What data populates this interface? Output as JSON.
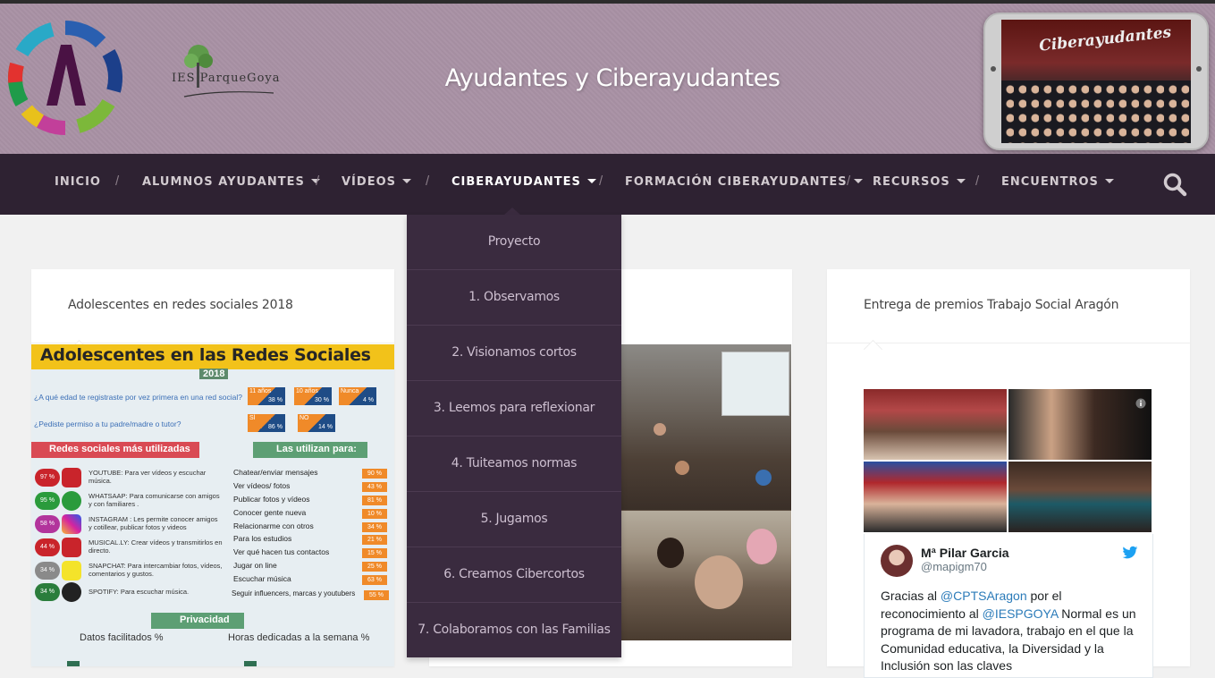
{
  "site": {
    "title": "Ayudantes y Ciberayudantes",
    "ies_logo_text": "IES ParqueGoya",
    "phone_banner_text": "Ciberayudantes"
  },
  "nav": {
    "items": [
      {
        "label": "INICIO",
        "has_caret": false
      },
      {
        "label": "ALUMNOS AYUDANTES",
        "has_caret": true
      },
      {
        "label": "VÍDEOS",
        "has_caret": true
      },
      {
        "label": "CIBERAYUDANTES",
        "has_caret": true,
        "active": true
      },
      {
        "label": "FORMACIÓN CIBERAYUDANTES",
        "has_caret": true
      },
      {
        "label": "RECURSOS",
        "has_caret": true
      },
      {
        "label": "ENCUENTROS",
        "has_caret": true
      }
    ],
    "separator": "/"
  },
  "dropdown": {
    "items": [
      "Proyecto",
      "1. Observamos",
      "2. Visionamos cortos",
      "3. Leemos para reflexionar",
      "4. Tuiteamos normas",
      "5. Jugamos",
      "6. Creamos Cibercortos",
      "7. Colaboramos con las Familias"
    ]
  },
  "cards": {
    "left_title": "Adolescentes en redes sociales 2018",
    "right_title": "Entrega de premios Trabajo Social Aragón"
  },
  "infographic": {
    "title": "Adolescentes en las Redes Sociales",
    "year": "2018",
    "q1": "¿A qué edad te registraste por vez primera en una red social?",
    "q1_boxes": [
      {
        "a": "11 años",
        "b": "38 %"
      },
      {
        "a": "10 años",
        "b": "30 %"
      },
      {
        "a": "Nunca",
        "b": "4 %"
      }
    ],
    "q2": "¿Pediste permiso a tu padre/madre o tutor?",
    "q2_boxes": [
      {
        "a": "SÍ",
        "b": "86 %"
      },
      {
        "a": "NO",
        "b": "14 %"
      }
    ],
    "section_left": "Redes sociales más utilizadas",
    "section_right": "Las utilizan para:",
    "networks": [
      {
        "pct": "97 %",
        "name": "YOUTUBE",
        "desc": "YOUTUBE: Para ver vídeos y escuchar música.",
        "color": "#c9242b"
      },
      {
        "pct": "95 %",
        "name": "WHATSAAP",
        "desc": "WHATSAAP: Para comunicarse con amigos y con familiares .",
        "color": "#2a9b3c"
      },
      {
        "pct": "58 %",
        "name": "INSTAGRAM",
        "desc": "INSTAGRAM : Les permite conocer amigos y cotillear, publicar fotos y videos",
        "color": "#b2349c"
      },
      {
        "pct": "44 %",
        "name": "MUSICAL.LY",
        "desc": "MUSICAL.LY: Crear vídeos y transmitirlos en directo.",
        "color": "#c9242b"
      },
      {
        "pct": "34 %",
        "name": "SNAPCHAT",
        "desc": "SNAPCHAT: Para intercambiar fotos, vídeos, comentarios y gustos.",
        "color": "#8a8a8a"
      },
      {
        "pct": "34 %",
        "name": "SPOTIFY",
        "desc": "SPOTIFY: Para escuchar música.",
        "color": "#2a7d3c"
      }
    ],
    "uses": [
      {
        "label": "Chatear/enviar mensajes",
        "pct": "90 %"
      },
      {
        "label": "Ver vídeos/ fotos",
        "pct": "43 %"
      },
      {
        "label": "Publicar fotos y vídeos",
        "pct": "81 %"
      },
      {
        "label": "Conocer gente nueva",
        "pct": "10 %"
      },
      {
        "label": "Relacionarme con otros",
        "pct": "34 %"
      },
      {
        "label": "Para los estudios",
        "pct": "21 %"
      },
      {
        "label": "Ver qué hacen tus contactos",
        "pct": "15 %"
      },
      {
        "label": "Jugar on line",
        "pct": "25 %"
      },
      {
        "label": "Escuchar música",
        "pct": "63 %"
      },
      {
        "label": "Seguir influencers, marcas y youtubers",
        "pct": "55 %"
      }
    ],
    "privacy_title": "Privacidad",
    "privacy_left": "Datos facilitados %",
    "privacy_right": "Horas dedicadas a la semana %"
  },
  "tweet": {
    "name": "Mª Pilar Garcia",
    "handle": "@mapigm70",
    "text_1": "Gracias al ",
    "mention_1": "@CPTSAragon",
    "text_2": " por el reconocimiento al ",
    "mention_2": "@IESPGOYA",
    "text_3": "  Normal es un programa de mi lavadora, trabajo en el que la  Comunidad educativa, la Diversidad y la Inclusión son las claves"
  },
  "colors": {
    "header_bg": "#a891a4",
    "nav_bg": "#2e2232",
    "dropdown_bg": "#3a2b3f",
    "twitter_blue": "#1da1f2"
  }
}
